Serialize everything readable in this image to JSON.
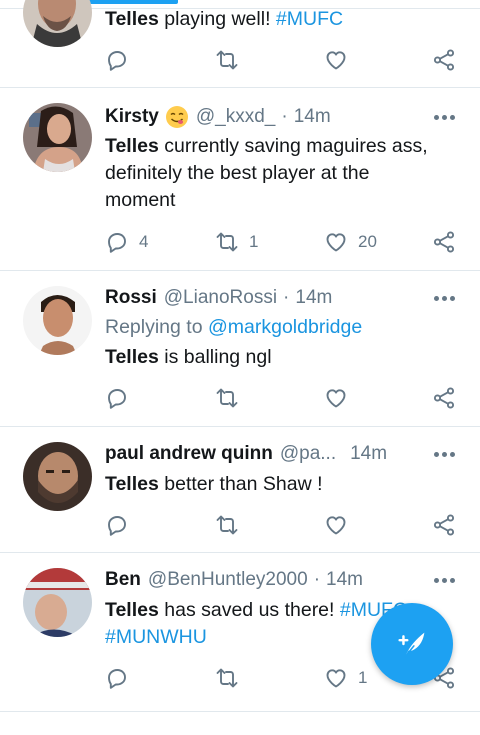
{
  "tweets": [
    {
      "name": "",
      "handle": "",
      "time": "",
      "bold": "Telles",
      "text": " playing well! ",
      "hashtag": "#MUFC",
      "reply": "",
      "retweet": "",
      "like": ""
    },
    {
      "name": "Kirsty",
      "emoji": "yum-face-emoji",
      "handle": "@_kxxd_",
      "time": "14m",
      "bold": "Telles",
      "line1": " currently saving maguires ass,",
      "line2": "definitely the best player at the",
      "line3": "moment",
      "reply": "4",
      "retweet": "1",
      "like": "20"
    },
    {
      "name": "Rossi",
      "handle": "@LianoRossi",
      "time": "14m",
      "replying_label": "Replying to ",
      "replying_to": "@markgoldbridge",
      "bold": "Telles",
      "text": " is balling ngl",
      "reply": "",
      "retweet": "",
      "like": ""
    },
    {
      "name": "paul andrew quinn",
      "handle": "@pa...",
      "time": "14m",
      "bold": "Telles",
      "text": " better than Shaw !",
      "reply": "",
      "retweet": "",
      "like": ""
    },
    {
      "name": "Ben",
      "handle": "@BenHuntley2000",
      "time": "14m",
      "bold": "Telles",
      "text": " has saved us there! ",
      "hashtag1": "#MUFC",
      "hashtag2": "#MUNWHU",
      "reply": "",
      "retweet": "",
      "like": "1"
    }
  ],
  "separator": "·",
  "icons": {
    "reply": "reply-icon",
    "retweet": "retweet-icon",
    "like": "heart-icon",
    "share": "share-icon",
    "more": "more-icon",
    "compose": "compose-tweet-icon"
  },
  "colors": {
    "accent": "#1da1f2",
    "link": "#1b95e0",
    "muted": "#657786",
    "text": "#14171a",
    "divider": "#e1e8ed"
  }
}
